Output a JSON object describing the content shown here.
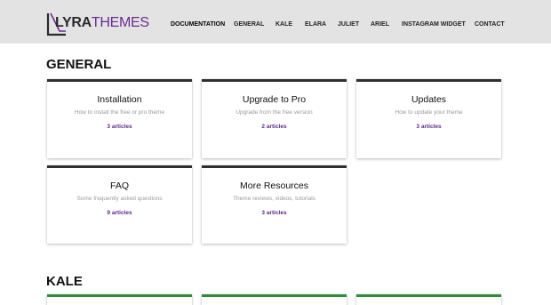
{
  "brand": {
    "logo_part1": "LYRA",
    "logo_part2": "THEMES"
  },
  "nav": {
    "items": [
      "DOCUMENTATION",
      "GENERAL",
      "KALE",
      "ELARA",
      "JULIET",
      "ARIEL",
      "INSTAGRAM WIDGET",
      "CONTACT"
    ],
    "active": "DOCUMENTATION"
  },
  "sections": [
    {
      "title": "GENERAL",
      "cards": [
        {
          "title": "Installation",
          "desc": "How to install the free or pro theme",
          "count": "3 articles"
        },
        {
          "title": "Upgrade to Pro",
          "desc": "Upgrade from the free version",
          "count": "2 articles"
        },
        {
          "title": "Updates",
          "desc": "How to update your theme",
          "count": "3 articles"
        },
        {
          "title": "FAQ",
          "desc": "Some frequently asked questions",
          "count": "9 articles"
        },
        {
          "title": "More Resources",
          "desc": "Theme reviews, videos, tutorials",
          "count": "3 articles"
        }
      ]
    },
    {
      "title": "KALE"
    }
  ],
  "colors": {
    "header_bg": "#e3e3e3",
    "brand_purple": "#6a2c91",
    "card_border_general": "#2f2f2f",
    "card_border_kale": "#2e8b3a"
  },
  "icons": {
    "logo": "lyra-logo-icon"
  }
}
